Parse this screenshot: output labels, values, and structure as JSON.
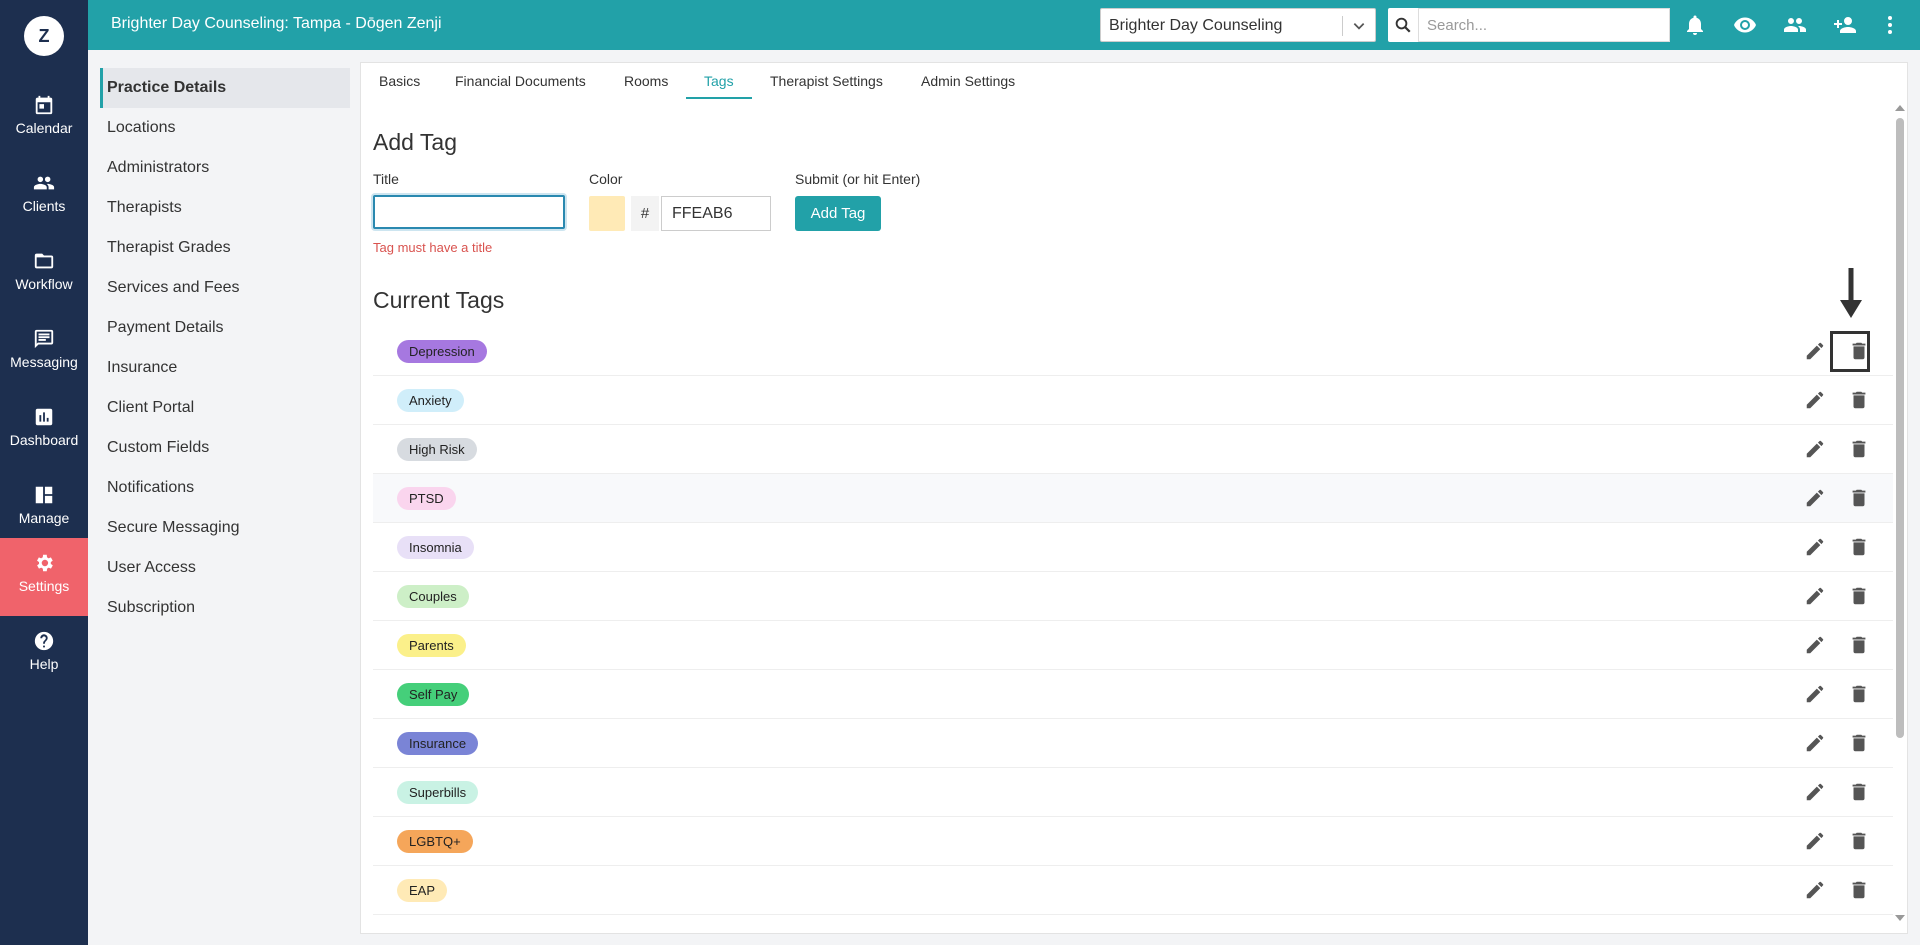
{
  "header": {
    "title": "Brighter Day Counseling: Tampa - Dōgen Zenji",
    "practice_select": "Brighter Day Counseling",
    "search_placeholder": "Search..."
  },
  "logo": "Z",
  "rail": [
    {
      "label": "Calendar",
      "icon": "calendar-icon"
    },
    {
      "label": "Clients",
      "icon": "clients-icon"
    },
    {
      "label": "Workflow",
      "icon": "folder-icon"
    },
    {
      "label": "Messaging",
      "icon": "message-icon"
    },
    {
      "label": "Dashboard",
      "icon": "chart-icon"
    },
    {
      "label": "Manage",
      "icon": "manage-icon"
    },
    {
      "label": "Settings",
      "icon": "gear-icon",
      "active": true
    },
    {
      "label": "Help",
      "icon": "help-icon"
    }
  ],
  "submenu": [
    "Practice Details",
    "Locations",
    "Administrators",
    "Therapists",
    "Therapist Grades",
    "Services and Fees",
    "Payment Details",
    "Insurance",
    "Client Portal",
    "Custom Fields",
    "Notifications",
    "Secure Messaging",
    "User Access",
    "Subscription"
  ],
  "tabs": [
    "Basics",
    "Financial Documents",
    "Rooms",
    "Tags",
    "Therapist Settings",
    "Admin Settings"
  ],
  "active_tab": "Tags",
  "add_tag": {
    "heading": "Add Tag",
    "title_label": "Title",
    "title_value": "",
    "error": "Tag must have a title",
    "color_label": "Color",
    "hash": "#",
    "color_value": "FFEAB6",
    "submit_label": "Submit (or hit Enter)",
    "button": "Add Tag"
  },
  "current_tags": {
    "heading": "Current Tags",
    "tags": [
      {
        "name": "Depression",
        "color": "#A678E0"
      },
      {
        "name": "Anxiety",
        "color": "#D0EEFA"
      },
      {
        "name": "High Risk",
        "color": "#D7DBE0"
      },
      {
        "name": "PTSD",
        "color": "#FAD5EE"
      },
      {
        "name": "Insomnia",
        "color": "#E8E0F7"
      },
      {
        "name": "Couples",
        "color": "#CDEFC7"
      },
      {
        "name": "Parents",
        "color": "#FBF08A"
      },
      {
        "name": "Self Pay",
        "color": "#45CF7A"
      },
      {
        "name": "Insurance",
        "color": "#7A84D6"
      },
      {
        "name": "Superbills",
        "color": "#C9F2E4"
      },
      {
        "name": "LGBTQ+",
        "color": "#F5A65A"
      },
      {
        "name": "EAP",
        "color": "#FFEAB6"
      }
    ]
  },
  "colors": {
    "brand": "#22a1a8",
    "rail": "#1d2f4f",
    "active_nav": "#f0636b",
    "error": "#d9534f"
  }
}
